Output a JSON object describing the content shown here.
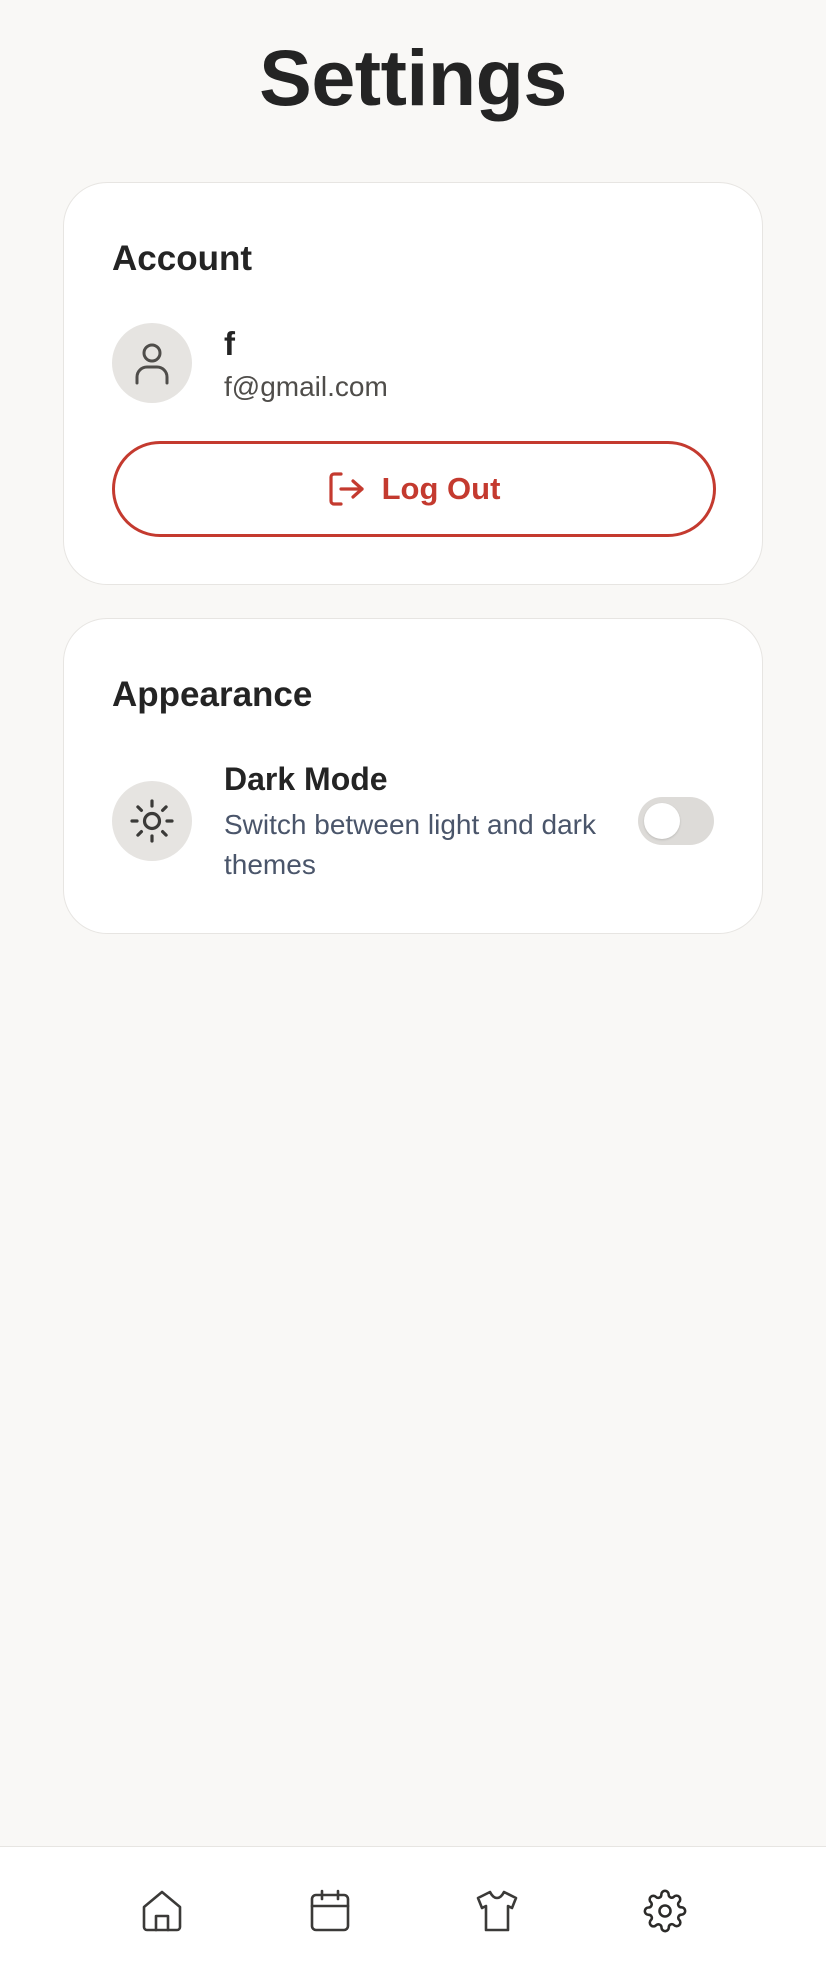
{
  "page": {
    "title": "Settings"
  },
  "account": {
    "section_title": "Account",
    "avatar_icon": "user-icon",
    "user_name": "f",
    "user_email": "f@gmail.com",
    "logout_label": "Log Out",
    "logout_icon": "log-out-icon"
  },
  "appearance": {
    "section_title": "Appearance",
    "dark_mode": {
      "icon": "sun-icon",
      "label": "Dark Mode",
      "description": "Switch between light and dark themes",
      "enabled": false
    }
  },
  "bottom_nav": {
    "items": [
      {
        "icon": "home-icon"
      },
      {
        "icon": "calendar-icon"
      },
      {
        "icon": "shirt-icon"
      },
      {
        "icon": "gear-icon",
        "active": true
      }
    ]
  },
  "colors": {
    "background": "#F9F8F6",
    "card": "#FFFFFF",
    "danger": "#C43A2F",
    "text_primary": "#242424",
    "text_secondary": "#4A556A",
    "icon_circle": "#E6E4E1",
    "toggle_off": "#DDDBD8"
  }
}
